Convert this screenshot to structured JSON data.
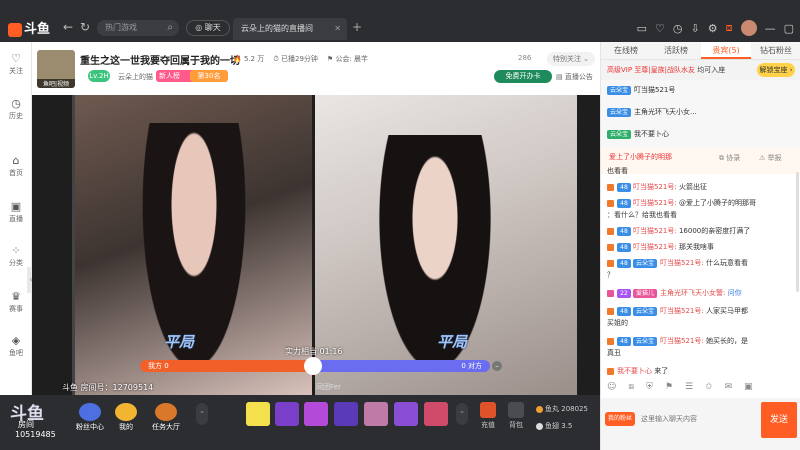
{
  "app": {
    "logo": "斗鱼"
  },
  "topbar": {
    "search_placeholder": "热门游戏",
    "chat_label": "聊天",
    "tab_title": "云朵上的猫的直播间"
  },
  "rail": {
    "items": [
      {
        "icon": "♡",
        "label": "关注"
      },
      {
        "icon": "◷",
        "label": "历史"
      },
      {
        "icon": "⌂",
        "label": "首页"
      },
      {
        "icon": "▣",
        "label": "直播"
      },
      {
        "icon": "⁘",
        "label": "分类"
      },
      {
        "icon": "♛",
        "label": "赛事"
      },
      {
        "icon": "◈",
        "label": "鱼吧"
      }
    ]
  },
  "header": {
    "avatar_tag": "鱼吧|视频",
    "title": "重生之这一世我要夺回属于我的一切",
    "hot": "5.2 万",
    "followers": "已播29分钟",
    "guild": "公会: 晨芊",
    "follow_count": "286",
    "follow_button": "特别关注 ⌄",
    "level": "Lv.2H",
    "name": "云朵上的猫",
    "rank1": "新人榜",
    "rank2": "第30名",
    "free_broadcast": "免费开办卡",
    "announce": "直播公告"
  },
  "video": {
    "draw_left": "平局",
    "draw_right": "平局",
    "timer": "实力相当 01:16",
    "left_label": "我方 0",
    "right_label": "0 对方",
    "opponent": "同团Fer",
    "room_no": "斗鱼 房间号：12709514"
  },
  "giftbar": {
    "big_logo": "斗鱼",
    "room_text": "房间",
    "room_big": "10519485",
    "acts": [
      {
        "label": "粉丝中心",
        "color": "#4d6fe0"
      },
      {
        "label": "我的",
        "color": "#f2b531"
      },
      {
        "label": "任务大厅",
        "color": "#d9772a"
      }
    ],
    "recharge": "充值",
    "backpack": "背包",
    "fishball_label": "鱼丸",
    "fishball": "208025",
    "fishfin_label": "鱼翅",
    "fishfin": "3.5"
  },
  "rpanel": {
    "tabs": [
      "在线榜",
      "活跃榜",
      "贵宾(5)",
      "钻石粉丝"
    ],
    "vip_prefix": "高级VIP",
    "vip_user": "至尊|皇族|战队水友",
    "vip_suffix": "均可入座",
    "unlock": "解锁宝座 ›",
    "top_msgs": [
      {
        "badge": "云朵宝",
        "text": "叮当猫521号"
      },
      {
        "badge": "云朵宝",
        "text": "主角光环飞天小女..."
      },
      {
        "badge": "云朵宝",
        "text": "我不要卜心"
      }
    ],
    "context": {
      "copy": "⧉ 协录",
      "report": "⚠ 举报",
      "line": "爱上了小腾子的明那"
    },
    "messages": [
      {
        "text": "也看看"
      },
      {
        "lvl": "48",
        "name": "叮当猫521号:",
        "text": "火箭出征"
      },
      {
        "lvl": "48",
        "name": "叮当猫521号:",
        "text": "@爱上了小腾子的明那哥"
      },
      {
        "text": "：看什么？给我也看看"
      },
      {
        "lvl": "48",
        "name": "叮当猫521号:",
        "text": "16000的亲密度打满了"
      },
      {
        "lvl": "48",
        "name": "叮当猫521号:",
        "text": "那关我啥事"
      },
      {
        "lvl": "48",
        "badge": "云朵宝",
        "name": "叮当猫521号:",
        "text": "什么玩意看看"
      },
      {
        "text": "？"
      },
      {
        "lvl": "22",
        "badge": "爱猫儿",
        "name": "主角光环飞天小女警:",
        "text": "问你"
      },
      {
        "lvl": "48",
        "badge": "云朵宝",
        "name": "叮当猫521号:",
        "text": "人家买马甲都"
      },
      {
        "text": "买姐的"
      },
      {
        "lvl": "48",
        "badge": "云朵宝",
        "name": "叮当猫521号:",
        "text": "她买长的，是"
      },
      {
        "text": "真丑"
      },
      {
        "name": "我不要卜心",
        "text": "来了"
      }
    ],
    "input_placeholder": "这里输入聊天内容",
    "fan_label": "我的粉丝",
    "send": "发送"
  }
}
